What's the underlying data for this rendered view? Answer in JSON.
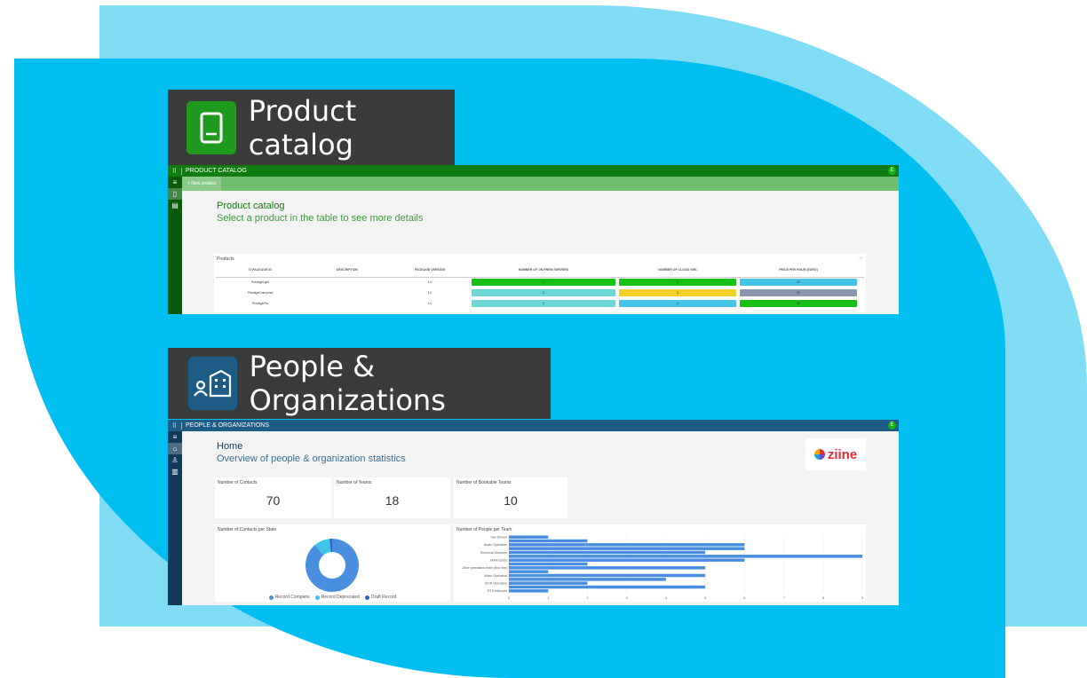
{
  "colors": {
    "background_light": "#80dcf4",
    "background_main": "#00bff0",
    "banner": "#3b3b3b",
    "product_theme": "#107c10",
    "people_theme": "#1d5c85",
    "bar_fill": "#4a8ee0"
  },
  "product_catalog": {
    "banner_title": "Product catalog",
    "banner_icon": "mobile-phone-icon",
    "app_bar_title": "PRODUCT CATALOG",
    "avatar_initial": "E",
    "command_new": "+ New product",
    "page_title": "Product catalog",
    "page_subtitle": "Select a product in the table to see more details",
    "products_card_label": "Products",
    "more_label": "...",
    "columns": [
      "IT PACKAGE ID",
      "DESCRIPTION",
      "PACKAGE VERSION",
      "NUMBER OF ON PREM SERVERS",
      "NUMBER OF CLOUD VMS",
      "PRICE PER HOUR (EURO)"
    ],
    "rows": [
      {
        "id": "PrestigeLight",
        "description": "",
        "version": "1.0",
        "on_prem": "1",
        "on_prem_color": "#16c016",
        "cloud": "1",
        "cloud_color": "#16c016",
        "price": "20",
        "price_color": "#46c4e8"
      },
      {
        "id": "PrestigeEnterprise",
        "description": "",
        "version": "1.0",
        "on_prem": "2",
        "on_prem_color": "#6fd6d6",
        "cloud": "3",
        "cloud_color": "#f2d02a",
        "price": "50",
        "price_color": "#8b95ae"
      },
      {
        "id": "PrestigePro",
        "description": "",
        "version": "1.0",
        "on_prem": "2",
        "on_prem_color": "#6fd6d6",
        "cloud": "2",
        "cloud_color": "#46c4e8",
        "price": "30",
        "price_color": "#16c016"
      }
    ]
  },
  "people": {
    "banner_title": "People & Organizations",
    "banner_icon": "people-buildings-icon",
    "app_bar_title": "PEOPLE & ORGANIZATIONS",
    "avatar_initial": "E",
    "page_title": "Home",
    "page_subtitle": "Overview of people & organization statistics",
    "logo_text": "ziine",
    "stats": {
      "contacts_label": "Number of Contacts",
      "contacts_value": "70",
      "teams_label": "Number of Teams",
      "teams_value": "18",
      "bookable_label": "Number of Bookable Teams",
      "bookable_value": "10"
    },
    "donut_title": "Number of Contacts per State",
    "legend": [
      {
        "label": "Record Complete",
        "color": "#4a8ee0"
      },
      {
        "label": "Record Deprecated",
        "color": "#3ec4e6"
      },
      {
        "label": "Draft Record",
        "color": "#2a64c8"
      }
    ],
    "bar_title": "Number of People per Team"
  },
  "chart_data": [
    {
      "type": "pie",
      "title": "Number of Contacts per State",
      "categories": [
        "Record Complete",
        "Record Deprecated",
        "Draft Record"
      ],
      "values": [
        62,
        7,
        1
      ]
    },
    {
      "type": "bar",
      "orientation": "horizontal",
      "title": "Number of People per Team",
      "categories": [
        "Van Drivers",
        "",
        "Audio Operation",
        "",
        "Technical Directors",
        "",
        "MAM Users",
        "",
        "Ziine operations team (first line)",
        "",
        "Video Operation",
        "",
        "MCR Operation",
        "",
        "RTS Intercom"
      ],
      "values": [
        1,
        2,
        6,
        6,
        5,
        9,
        6,
        2,
        5,
        1,
        5,
        4,
        2,
        5,
        1
      ],
      "xlim": [
        0,
        9
      ],
      "xticks": [
        "0",
        "1",
        "2",
        "3",
        "4",
        "5",
        "6",
        "7",
        "8",
        "9"
      ],
      "grid": true
    }
  ]
}
